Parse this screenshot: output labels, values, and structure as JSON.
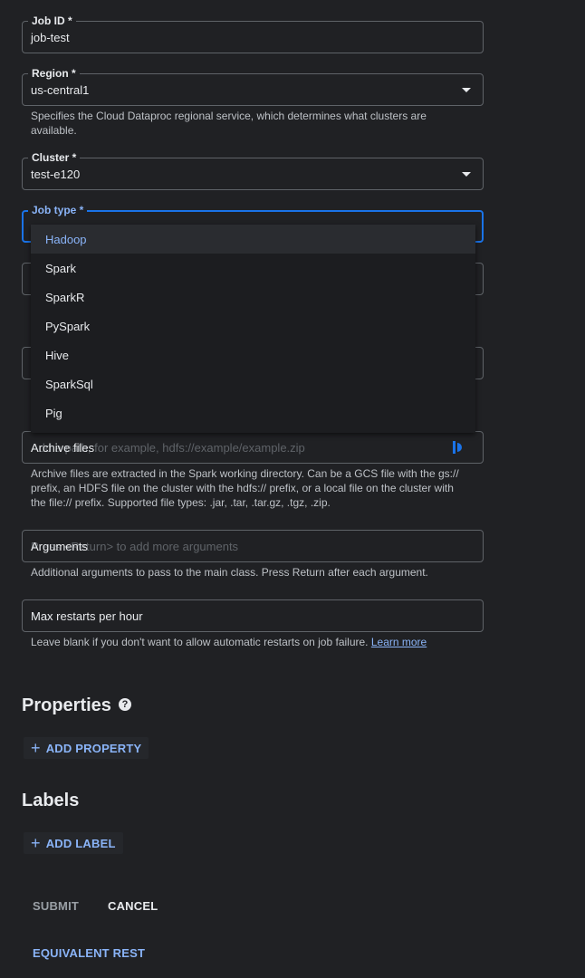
{
  "job_id": {
    "label": "Job ID *",
    "value": "job-test"
  },
  "region": {
    "label": "Region *",
    "value": "us-central1",
    "hint": "Specifies the Cloud Dataproc regional service, which determines what clusters are available."
  },
  "cluster": {
    "label": "Cluster *",
    "value": "test-e120"
  },
  "job_type": {
    "label": "Job type *",
    "options": [
      "Hadoop",
      "Spark",
      "SparkR",
      "PySpark",
      "Hive",
      "SparkSql",
      "Pig"
    ],
    "highlighted_option": "Hadoop"
  },
  "archive_files": {
    "label": "Archive files",
    "placeholder": "Add a path, for example, hdfs://example/example.zip",
    "hint": "Archive files are extracted in the Spark working directory. Can be a GCS file with the gs:// prefix, an HDFS file on the cluster with the hdfs:// prefix, or a local file on the cluster with the file:// prefix. Supported file types: .jar, .tar, .tar.gz, .tgz, .zip."
  },
  "arguments": {
    "label": "Arguments",
    "placeholder": "Press <Return> to add more arguments",
    "hint": "Additional arguments to pass to the main class. Press Return after each argument."
  },
  "max_restarts": {
    "label": "Max restarts per hour",
    "placeholder": "Max",
    "hint": "Leave blank if you don't want to allow automatic restarts on job failure.",
    "link": "Learn more"
  },
  "properties": {
    "title": "Properties",
    "button": "ADD PROPERTY"
  },
  "labels": {
    "title": "Labels",
    "button": "ADD LABEL"
  },
  "actions": {
    "submit": "SUBMIT",
    "cancel": "CANCEL",
    "equivalent_rest": "EQUIVALENT REST"
  },
  "colors": {
    "accent": "#8ab4f8",
    "focus_border": "#1a73e8",
    "background": "#202124"
  }
}
